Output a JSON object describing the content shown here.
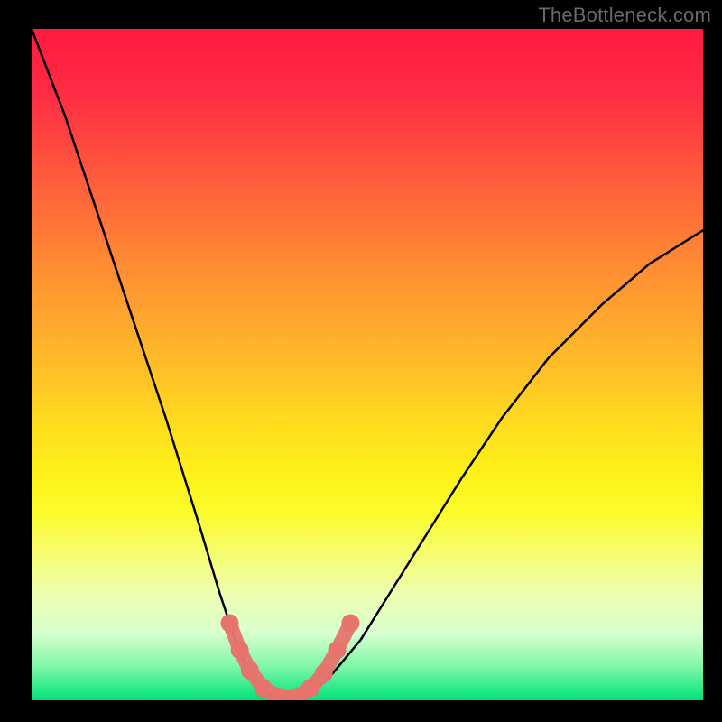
{
  "watermark": "TheBottleneck.com",
  "chart_data": {
    "type": "line",
    "title": "",
    "xlabel": "",
    "ylabel": "",
    "xlim": [
      0,
      1
    ],
    "ylim": [
      0,
      1
    ],
    "series": [
      {
        "name": "curve",
        "x": [
          0.0,
          0.05,
          0.1,
          0.15,
          0.2,
          0.25,
          0.28,
          0.31,
          0.33,
          0.35,
          0.37,
          0.39,
          0.41,
          0.44,
          0.49,
          0.54,
          0.59,
          0.64,
          0.7,
          0.77,
          0.85,
          0.92,
          1.0
        ],
        "y": [
          1.0,
          0.87,
          0.72,
          0.57,
          0.42,
          0.26,
          0.16,
          0.07,
          0.03,
          0.01,
          0.0,
          0.0,
          0.01,
          0.03,
          0.09,
          0.17,
          0.25,
          0.33,
          0.42,
          0.51,
          0.59,
          0.65,
          0.7
        ]
      },
      {
        "name": "markers",
        "x": [
          0.295,
          0.31,
          0.325,
          0.345,
          0.37,
          0.395,
          0.415,
          0.435,
          0.455,
          0.475
        ],
        "y": [
          0.115,
          0.075,
          0.045,
          0.018,
          0.005,
          0.005,
          0.018,
          0.04,
          0.075,
          0.115
        ]
      }
    ],
    "colors": {
      "curve": "#000000",
      "markers": "#e6746c"
    }
  }
}
